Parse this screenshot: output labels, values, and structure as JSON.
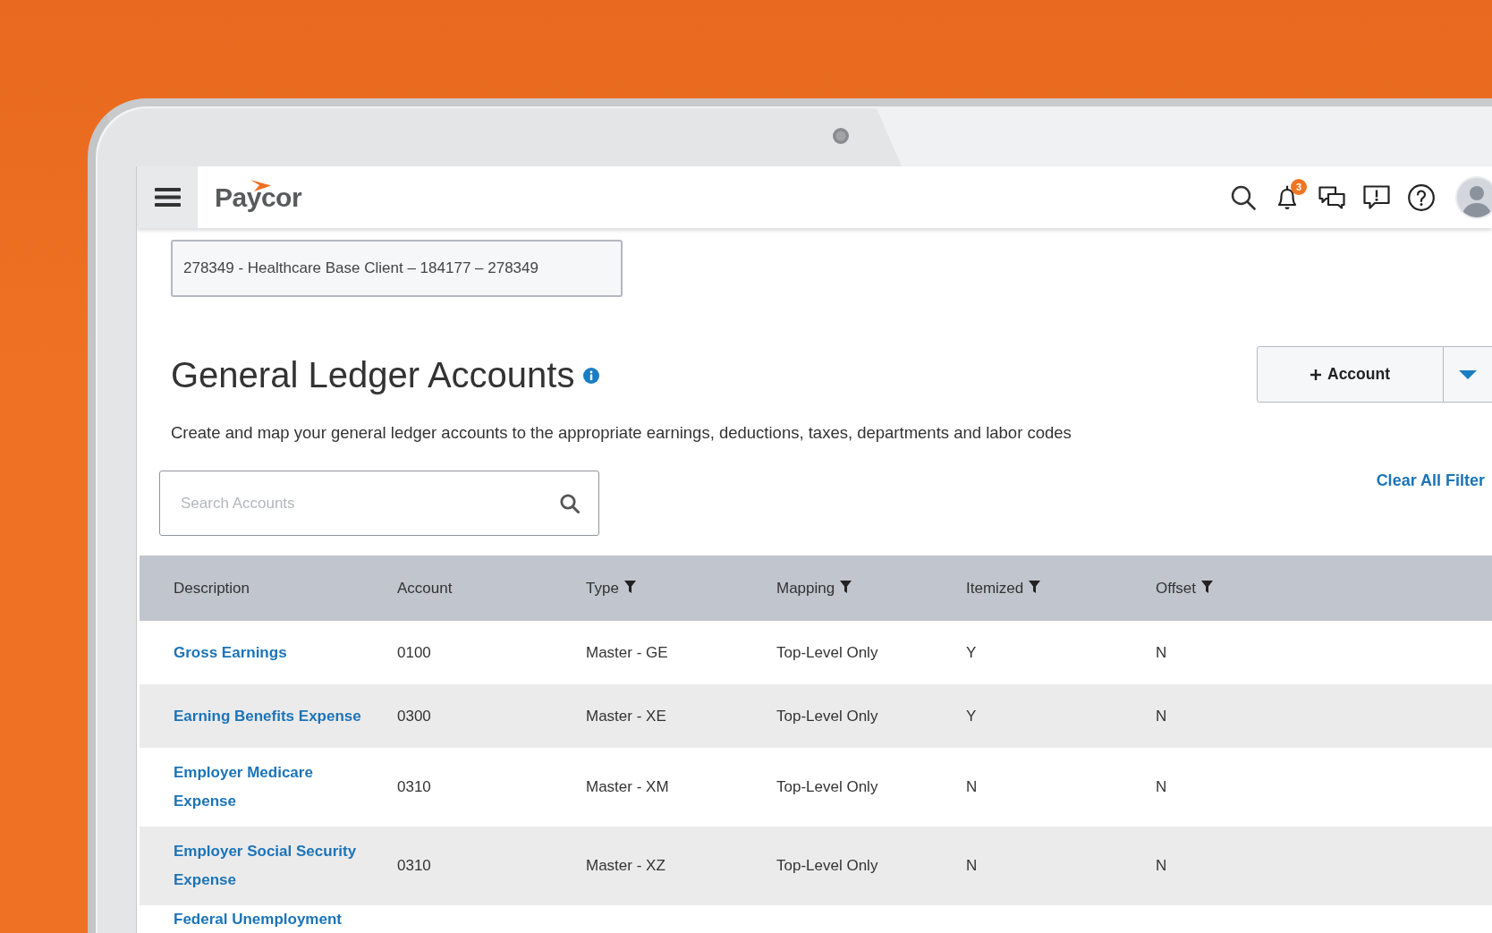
{
  "header": {
    "logo": "Paycor",
    "notification_count": "3"
  },
  "client_selector": {
    "value": "278349 - Healthcare Base Client – 184177 – 278349"
  },
  "page": {
    "title": "General Ledger Accounts",
    "description": "Create and map your general ledger accounts to the appropriate earnings, deductions, taxes, departments and labor codes",
    "add_button": "Account",
    "clear_filters": "Clear All Filter"
  },
  "search": {
    "placeholder": "Search Accounts"
  },
  "table": {
    "columns": [
      {
        "label": "Description",
        "filter": false
      },
      {
        "label": "Account",
        "filter": false
      },
      {
        "label": "Type",
        "filter": true
      },
      {
        "label": "Mapping",
        "filter": true
      },
      {
        "label": "Itemized",
        "filter": true
      },
      {
        "label": "Offset",
        "filter": true
      }
    ],
    "rows": [
      {
        "description": "Gross Earnings",
        "account": "0100",
        "type": "Master - GE",
        "mapping": "Top-Level Only",
        "itemized": "Y",
        "offset": "N"
      },
      {
        "description": "Earning Benefits Expense",
        "account": "0300",
        "type": "Master - XE",
        "mapping": "Top-Level Only",
        "itemized": "Y",
        "offset": "N"
      },
      {
        "description": "Employer Medicare Expense",
        "account": "0310",
        "type": "Master - XM",
        "mapping": "Top-Level Only",
        "itemized": "N",
        "offset": "N"
      },
      {
        "description": "Employer Social Security Expense",
        "account": "0310",
        "type": "Master - XZ",
        "mapping": "Top-Level Only",
        "itemized": "N",
        "offset": "N"
      },
      {
        "description": "Federal Unemployment"
      }
    ]
  }
}
